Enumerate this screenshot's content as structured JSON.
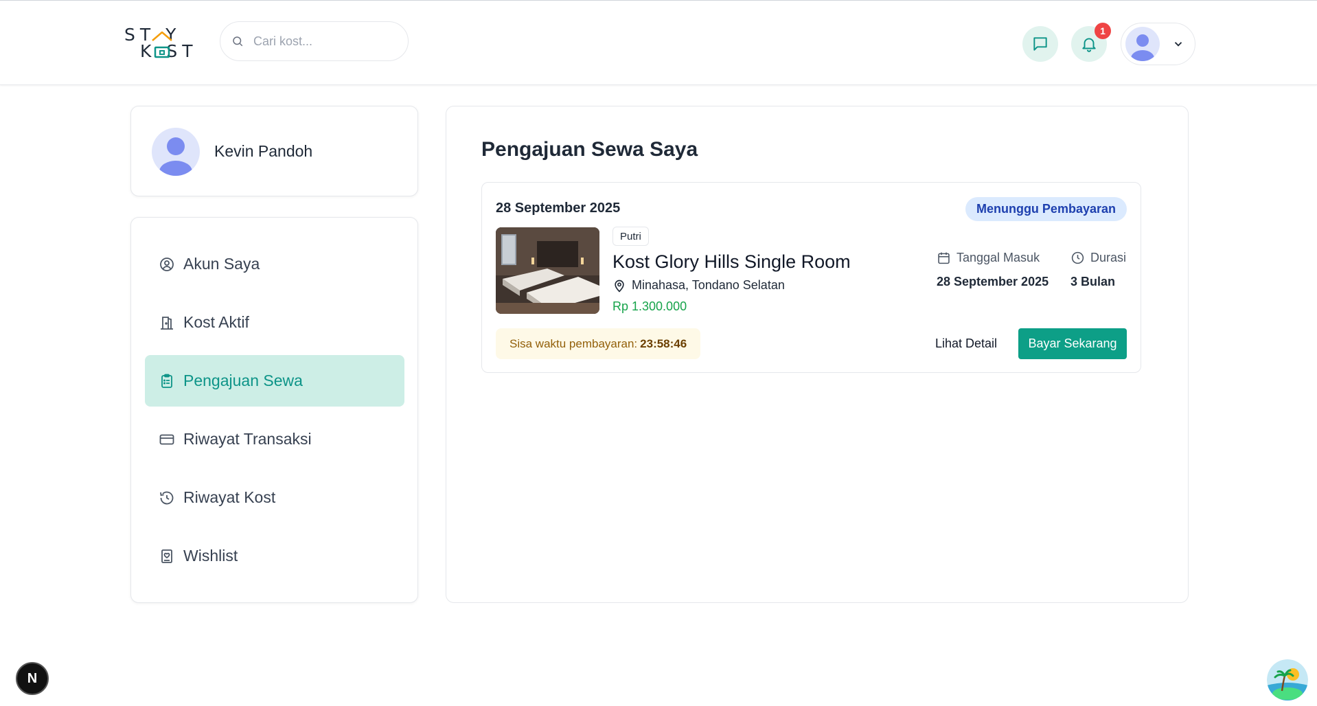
{
  "header": {
    "logo_top": "ST Y",
    "logo_bottom": "K ST",
    "search_placeholder": "Cari kost...",
    "notification_count": "1"
  },
  "profile": {
    "name": "Kevin Pandoh"
  },
  "nav": {
    "items": [
      {
        "label": "Akun Saya",
        "icon": "user-circle-icon"
      },
      {
        "label": "Kost Aktif",
        "icon": "door-icon"
      },
      {
        "label": "Pengajuan Sewa",
        "icon": "clipboard-list-icon",
        "active": true
      },
      {
        "label": "Riwayat Transaksi",
        "icon": "credit-card-icon"
      },
      {
        "label": "Riwayat Kost",
        "icon": "history-icon"
      },
      {
        "label": "Wishlist",
        "icon": "bookmark-heart-icon"
      }
    ]
  },
  "main": {
    "title": "Pengajuan Sewa Saya",
    "rental": {
      "date": "28 September 2025",
      "status": "Menunggu Pembayaran",
      "gender": "Putri",
      "room_name": "Kost Glory Hills Single Room",
      "location": "Minahasa, Tondano Selatan",
      "price": "Rp 1.300.000",
      "checkin_label": "Tanggal Masuk",
      "checkin_value": "28 September 2025",
      "duration_label": "Durasi",
      "duration_value": "3 Bulan",
      "timer_label": "Sisa waktu pembayaran:",
      "timer_value": "23:58:46",
      "detail_label": "Lihat Detail",
      "pay_label": "Bayar Sekarang"
    }
  },
  "colors": {
    "accent": "#0d9f87",
    "active_bg": "#cdeee6",
    "status_bg": "#dbeafe",
    "price": "#16a34a",
    "badge": "#ef4444"
  },
  "dev_badge": "N"
}
